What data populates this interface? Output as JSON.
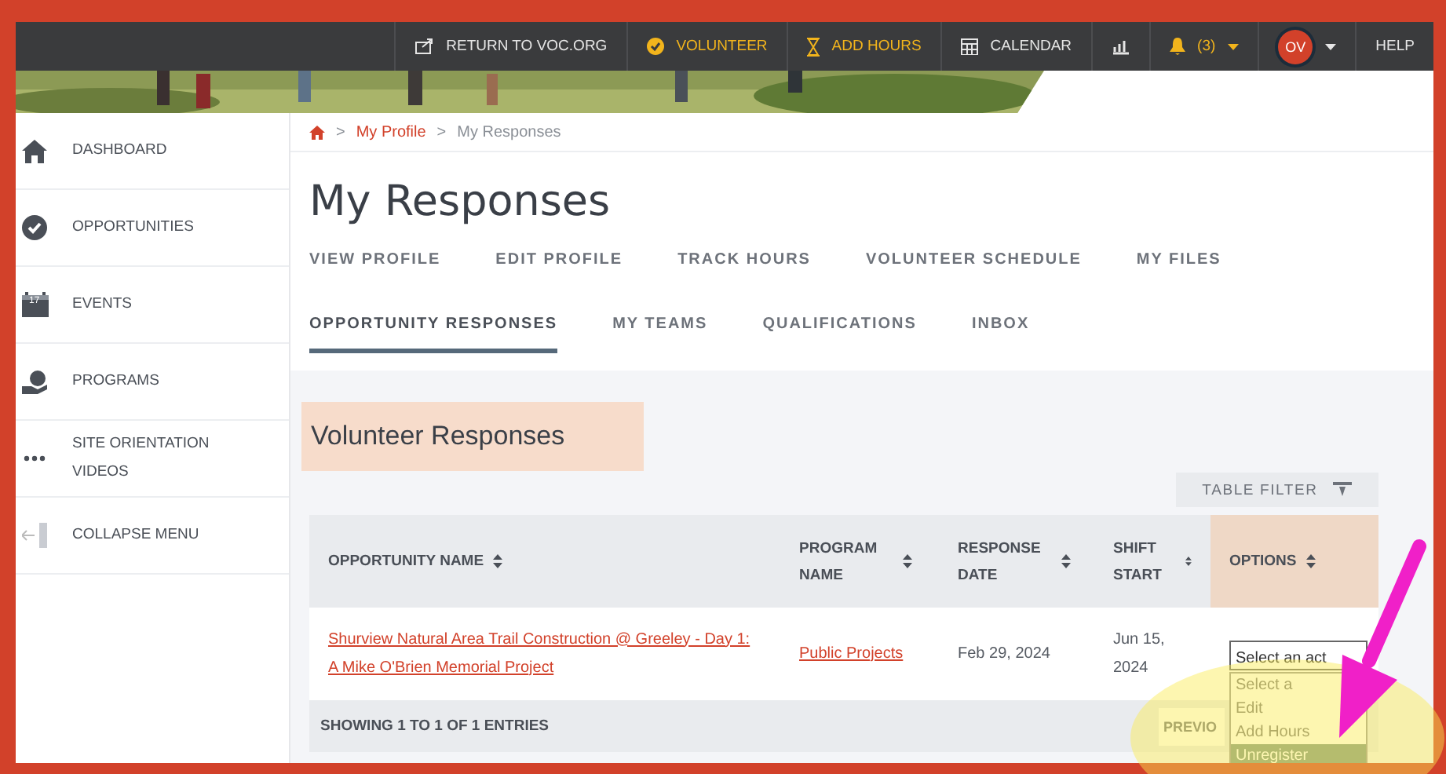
{
  "nav": {
    "items": [
      {
        "kind": "return",
        "label": "RETURN TO VOC.ORG",
        "accent": false
      },
      {
        "kind": "check",
        "label": "VOLUNTEER",
        "accent": true
      },
      {
        "kind": "hourglass",
        "label": "ADD HOURS",
        "accent": true
      },
      {
        "kind": "calendar",
        "label": "CALENDAR",
        "accent": false
      },
      {
        "kind": "chart"
      },
      {
        "kind": "bell",
        "label": "(3)",
        "accent": true
      },
      {
        "kind": "avatar",
        "label": "OV"
      },
      {
        "kind": "text",
        "label": "HELP",
        "accent": false
      }
    ]
  },
  "sidebar": {
    "items": [
      {
        "kind": "home",
        "label": "DASHBOARD"
      },
      {
        "kind": "check",
        "label": "OPPORTUNITIES"
      },
      {
        "kind": "calendar",
        "label": "EVENTS",
        "badge": "17"
      },
      {
        "kind": "hand",
        "label": "PROGRAMS"
      },
      {
        "kind": "dots",
        "label": "SITE ORIENTATION VIDEOS"
      },
      {
        "kind": "collapse",
        "label": "COLLAPSE MENU"
      }
    ]
  },
  "breadcrumb": {
    "items": [
      {
        "kind": "separator",
        "label": ">"
      },
      {
        "kind": "link",
        "label": "My Profile"
      },
      {
        "kind": "separator",
        "label": ">"
      },
      {
        "kind": "current",
        "label": "My Responses"
      }
    ]
  },
  "title": "My Responses",
  "tabs": [
    [
      {
        "label": "VIEW PROFILE",
        "selected": false
      },
      {
        "label": "EDIT PROFILE",
        "selected": false
      },
      {
        "label": "TRACK HOURS",
        "selected": false
      },
      {
        "label": "VOLUNTEER SCHEDULE",
        "selected": false
      },
      {
        "label": "MY FILES",
        "selected": false
      }
    ],
    [
      {
        "label": "OPPORTUNITY RESPONSES",
        "selected": true
      },
      {
        "label": "MY TEAMS",
        "selected": false
      },
      {
        "label": "QUALIFICATIONS",
        "selected": false
      },
      {
        "label": "INBOX",
        "selected": false
      }
    ]
  ],
  "section": {
    "heading": "Volunteer Responses",
    "highlighted": true
  },
  "table_filter": "TABLE FILTER",
  "table": {
    "columns": [
      {
        "label": "OPPORTUNITY NAME",
        "highlighted": false
      },
      {
        "label": "PROGRAM NAME",
        "highlighted": false
      },
      {
        "label": "RESPONSE DATE",
        "highlighted": false
      },
      {
        "label": "SHIFT START",
        "highlighted": false
      },
      {
        "label": "OPTIONS",
        "highlighted": true
      }
    ],
    "rows": [
      {
        "opportunity": "Shurview Natural Area Trail Construction @ Greeley - Day 1: A Mike O'Brien Memorial Project",
        "program": "Public Projects",
        "response_date": "Feb 29, 2024",
        "shift_start": "Jun 15, 2024",
        "select": {
          "value": "Select an act",
          "options": [
            {
              "label": "Select a",
              "selected": false
            },
            {
              "label": "Edit",
              "selected": false
            },
            {
              "label": "Add Hours",
              "selected": false
            },
            {
              "label": "Unregister",
              "selected": true
            }
          ]
        }
      }
    ],
    "footer": "SHOWING 1 TO 1 OF 1 ENTRIES",
    "pager": "PREVIO"
  }
}
